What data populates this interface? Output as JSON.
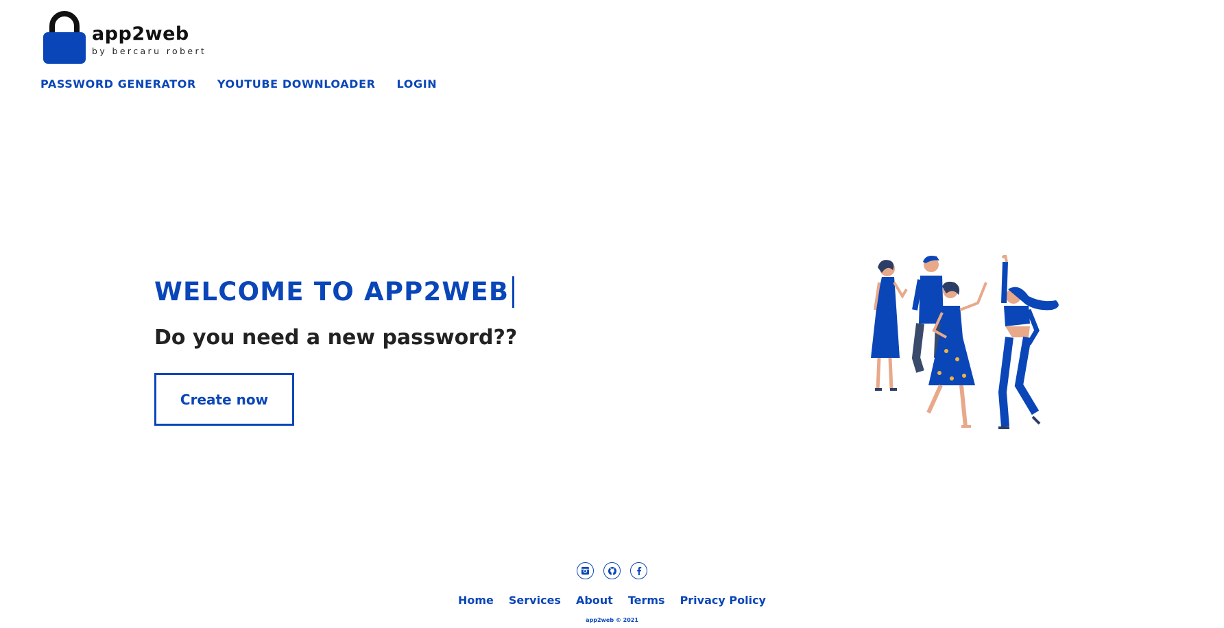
{
  "brand": {
    "name": "app2web",
    "tagline": "by bercaru robert",
    "logo_icon": "lock-icon"
  },
  "nav": {
    "items": [
      {
        "label": "PASSWORD GENERATOR"
      },
      {
        "label": "YOUTUBE DOWNLOADER"
      },
      {
        "label": "LOGIN"
      }
    ]
  },
  "hero": {
    "title": "WELCOME TO APP2WEB",
    "subtitle": "Do you need a new password??",
    "cta_label": "Create now"
  },
  "footer": {
    "social": [
      {
        "icon": "instagram-icon"
      },
      {
        "icon": "github-icon"
      },
      {
        "icon": "facebook-icon"
      }
    ],
    "links": [
      {
        "label": "Home"
      },
      {
        "label": "Services"
      },
      {
        "label": "About"
      },
      {
        "label": "Terms"
      },
      {
        "label": "Privacy Policy"
      }
    ],
    "copyright": "app2web © 2021"
  },
  "colors": {
    "accent": "#0a46b8",
    "text_dark": "#222222",
    "skin": "#e8a88a",
    "dots": "#f0b440"
  }
}
